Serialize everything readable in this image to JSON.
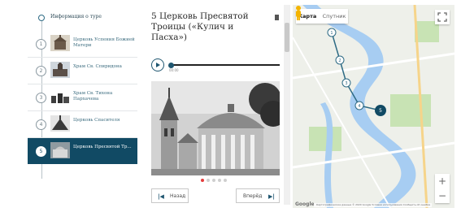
{
  "route": {
    "header": "Информация о туре",
    "stops": [
      {
        "num": "1",
        "label": "Церковь Успения Божией Матери"
      },
      {
        "num": "2",
        "label": "Храм Св. Спиридона"
      },
      {
        "num": "3",
        "label": "Храм Св. Тихона Пархачева"
      },
      {
        "num": "4",
        "label": "Церковь Спасителя"
      },
      {
        "num": "5",
        "label": "Церковь Пресвятой Тр..."
      }
    ],
    "active_index": 4
  },
  "detail": {
    "title": "5 Церковь Пресвятой Троицы («Кулич и Пасха»)",
    "audio": {
      "time": "00:00",
      "progress": 0.0
    },
    "gallery": {
      "count": 5,
      "active": 0
    },
    "prev_label": "Назад",
    "next_label": "Вперёд"
  },
  "map": {
    "tab_map": "Карта",
    "tab_satellite": "Спутник",
    "zoom_in": "+",
    "zoom_out": "−",
    "footer": "Картографические данные © 2020 Google   Условия использования   Сообщить об ошибке на карте",
    "logo": "Google",
    "markers": [
      "1",
      "2",
      "3",
      "4",
      "5"
    ],
    "active_marker": "5",
    "colors": {
      "route": "#2d6a84",
      "water": "#a7cdf2",
      "park": "#c8e3b4",
      "active": "#114a64"
    }
  }
}
